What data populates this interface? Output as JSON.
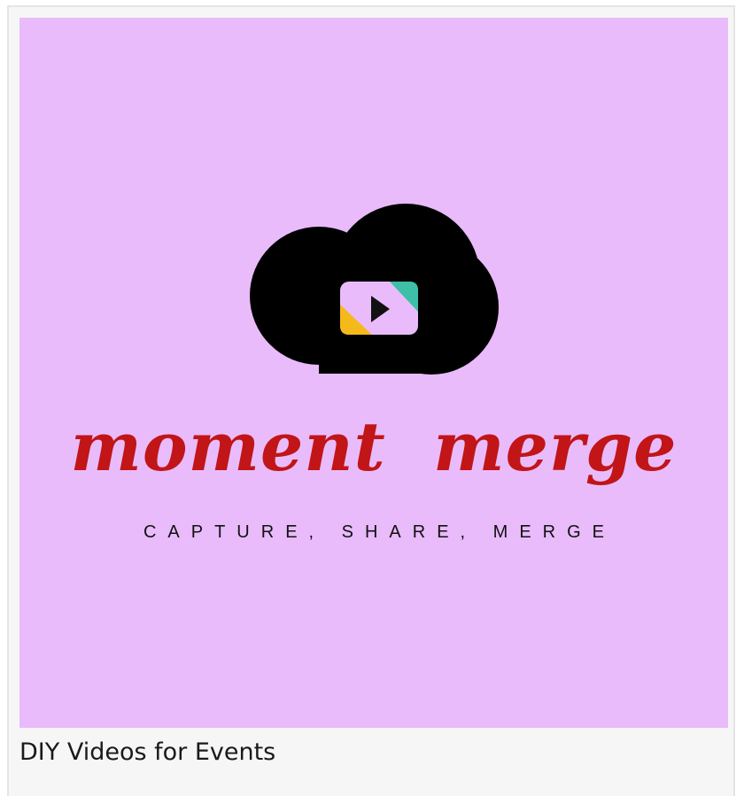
{
  "poster": {
    "brand_name": "moment merge",
    "tagline": "CAPTURE, SHARE, MERGE",
    "logo_icon": "cloud-play-icon",
    "colors": {
      "background": "#e9bbfb",
      "brand_text": "#c11517",
      "cloud": "#000000",
      "play_screen": "#e9bbfb",
      "accent_teal": "#3dbfa8",
      "accent_yellow": "#f6b91a"
    }
  },
  "caption": "DIY Videos for Events"
}
